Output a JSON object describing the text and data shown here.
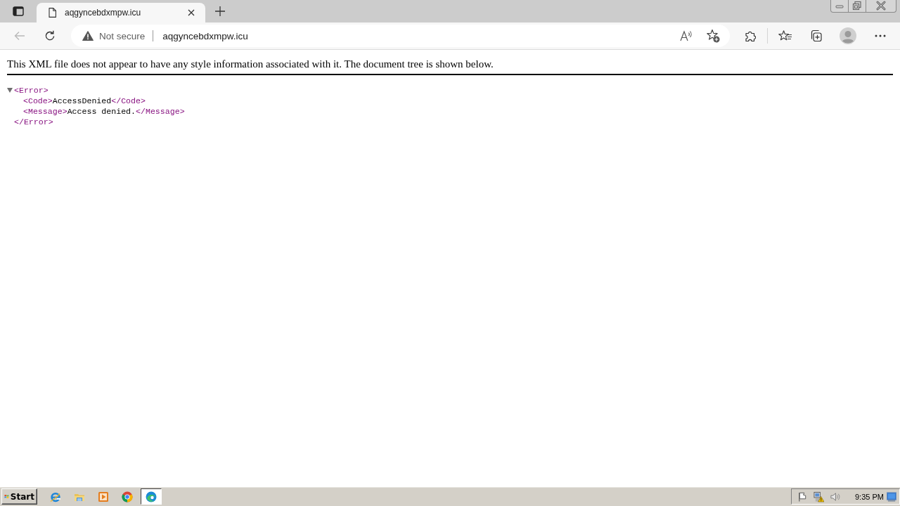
{
  "browser": {
    "tabs": [
      {
        "title": "aqgyncebdxmpw.icu",
        "selected": true
      }
    ],
    "back_button": {
      "disabled": true
    },
    "address_bar": {
      "security_label": "Not secure",
      "url": "aqgyncebdxmpw.icu"
    }
  },
  "page": {
    "notice": "This XML file does not appear to have any style information associated with it. The document tree is shown below.",
    "xml_tree": [
      {
        "open_tag": "<Error>",
        "expanded": true,
        "children": [
          {
            "open_tag": "<Code>",
            "text": "AccessDenied",
            "close_tag": "</Code>"
          },
          {
            "open_tag": "<Message>",
            "text": "Access denied.",
            "close_tag": "</Message>"
          }
        ],
        "close_tag": "</Error>"
      }
    ]
  },
  "taskbar": {
    "start_label": "Start",
    "apps": [
      {
        "kind": "ie",
        "selected": false
      },
      {
        "kind": "explorer",
        "selected": false
      },
      {
        "kind": "player",
        "selected": false
      },
      {
        "kind": "chrome",
        "selected": false
      },
      {
        "kind": "edge",
        "selected": true
      }
    ],
    "clock": "9:35 PM"
  }
}
